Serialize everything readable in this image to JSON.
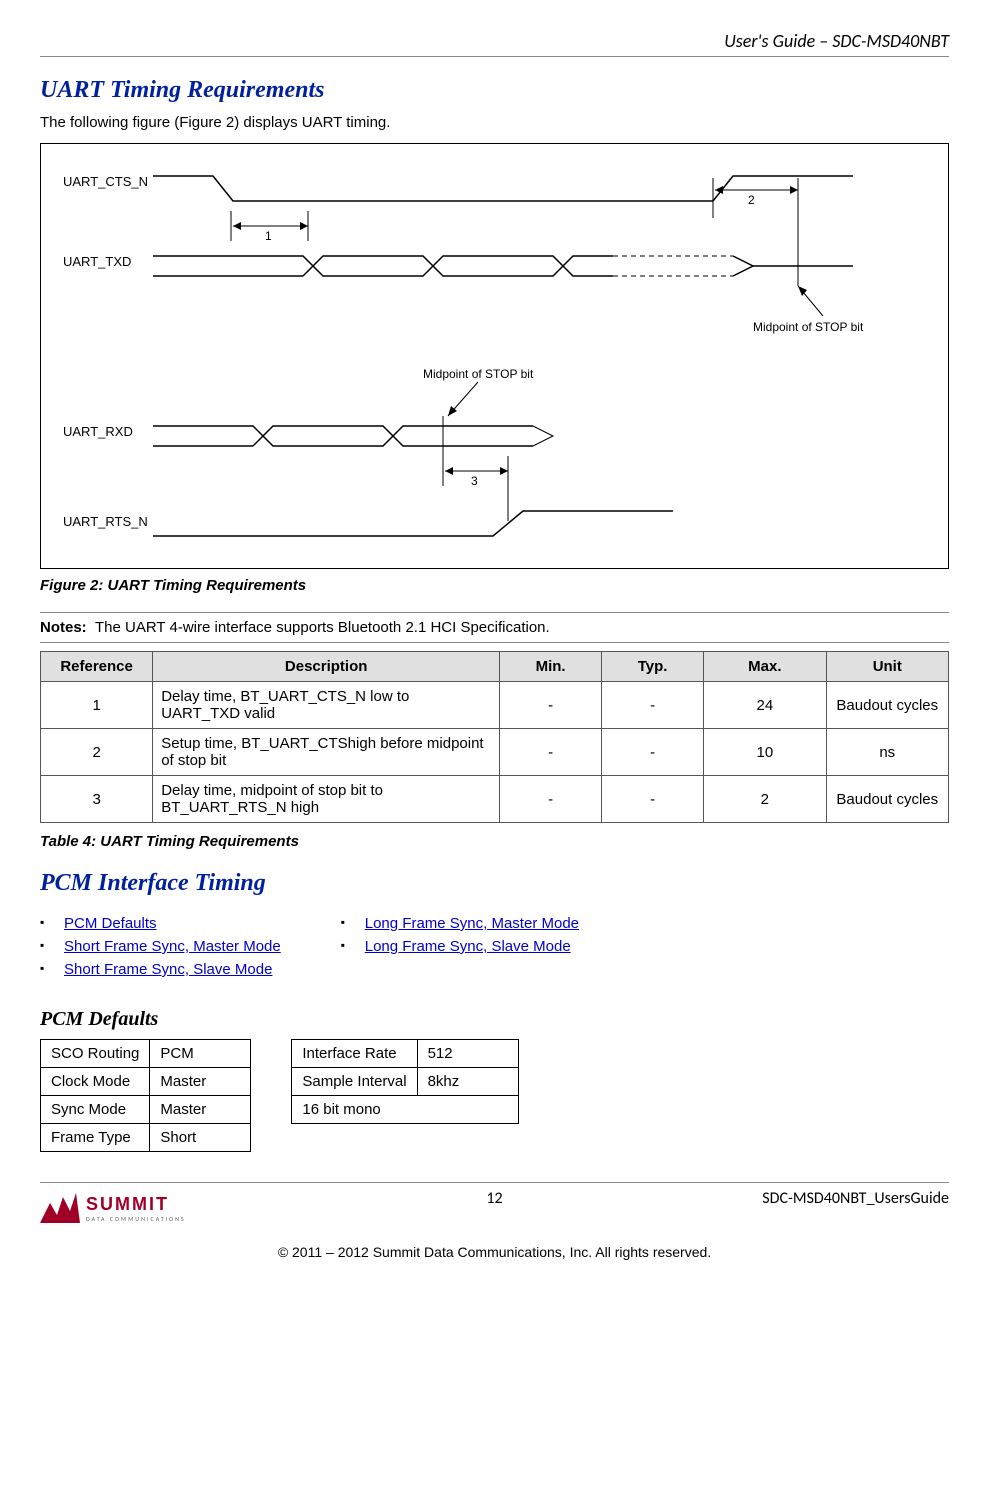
{
  "header": "User's Guide – SDC-MSD40NBT",
  "section1_title": "UART Timing Requirements",
  "intro_para": "The following figure (Figure 2) displays UART timing.",
  "fig2_caption": "Figure 2: UART Timing Requirements",
  "diagram": {
    "sig_cts": "UART_CTS_N",
    "sig_txd": "UART_TXD",
    "sig_rxd": "UART_RXD",
    "sig_rts": "UART_RTS_N",
    "m1": "1",
    "m2": "2",
    "m3": "3",
    "midpoint": "Midpoint of STOP bit"
  },
  "notes_label": "Notes:",
  "notes_text": "The UART 4-wire interface supports Bluetooth 2.1 HCI Specification.",
  "table4": {
    "headers": [
      "Reference",
      "Description",
      "Min.",
      "Typ.",
      "Max.",
      "Unit"
    ],
    "rows": [
      [
        "1",
        "Delay time, BT_UART_CTS_N low to UART_TXD valid",
        "-",
        "-",
        "24",
        "Baudout cycles"
      ],
      [
        "2",
        "Setup time, BT_UART_CTShigh before midpoint of stop bit",
        "-",
        "-",
        "10",
        "ns"
      ],
      [
        "3",
        "Delay time, midpoint of stop bit to BT_UART_RTS_N high",
        "-",
        "-",
        "2",
        "Baudout cycles"
      ]
    ],
    "caption": "Table 4: UART Timing Requirements"
  },
  "section2_title": "PCM Interface Timing",
  "links": {
    "col1": [
      "PCM Defaults",
      "Short Frame Sync, Master Mode",
      "Short Frame Sync, Slave Mode"
    ],
    "col2": [
      "Long Frame Sync, Master Mode",
      "Long Frame Sync, Slave Mode"
    ]
  },
  "pcm_defaults_heading": "PCM Defaults",
  "pcm_left": [
    [
      "SCO Routing",
      "PCM"
    ],
    [
      "Clock Mode",
      "Master"
    ],
    [
      "Sync Mode",
      "Master"
    ],
    [
      "Frame Type",
      "Short"
    ]
  ],
  "pcm_right": [
    [
      "Interface Rate",
      "512"
    ],
    [
      "Sample Interval",
      "8khz"
    ],
    [
      "16 bit mono",
      ""
    ]
  ],
  "footer": {
    "page": "12",
    "right": "SDC-MSD40NBT_UsersGuide",
    "logo_text": "SUMMIT",
    "logo_sub": "DATA COMMUNICATIONS",
    "copyright": "© 2011 – 2012 Summit Data Communications, Inc. All rights reserved."
  }
}
